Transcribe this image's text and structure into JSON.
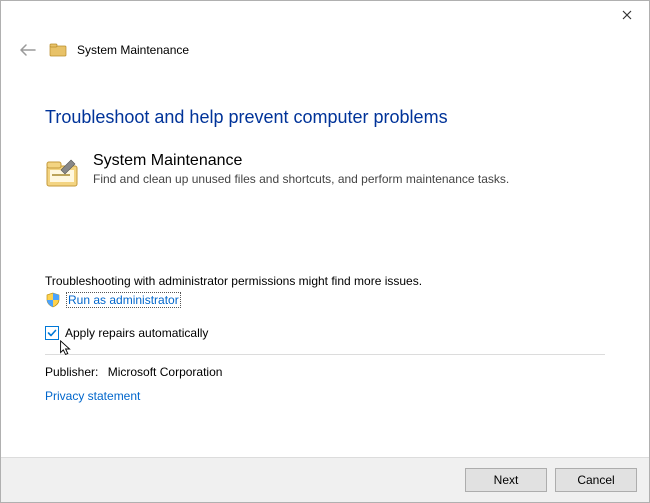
{
  "titlebar": {
    "close_tooltip": "Close"
  },
  "header": {
    "title": "System Maintenance"
  },
  "main": {
    "heading": "Troubleshoot and help prevent computer problems",
    "section_title": "System Maintenance",
    "section_desc": "Find and clean up unused files and shortcuts, and perform maintenance tasks."
  },
  "admin": {
    "hint": "Troubleshooting with administrator permissions might find more issues.",
    "link": "Run as administrator"
  },
  "apply": {
    "label": "Apply repairs automatically",
    "checked": true
  },
  "publisher": {
    "label": "Publisher:",
    "value": "Microsoft Corporation"
  },
  "privacy": {
    "link": "Privacy statement"
  },
  "footer": {
    "next": "Next",
    "cancel": "Cancel"
  }
}
